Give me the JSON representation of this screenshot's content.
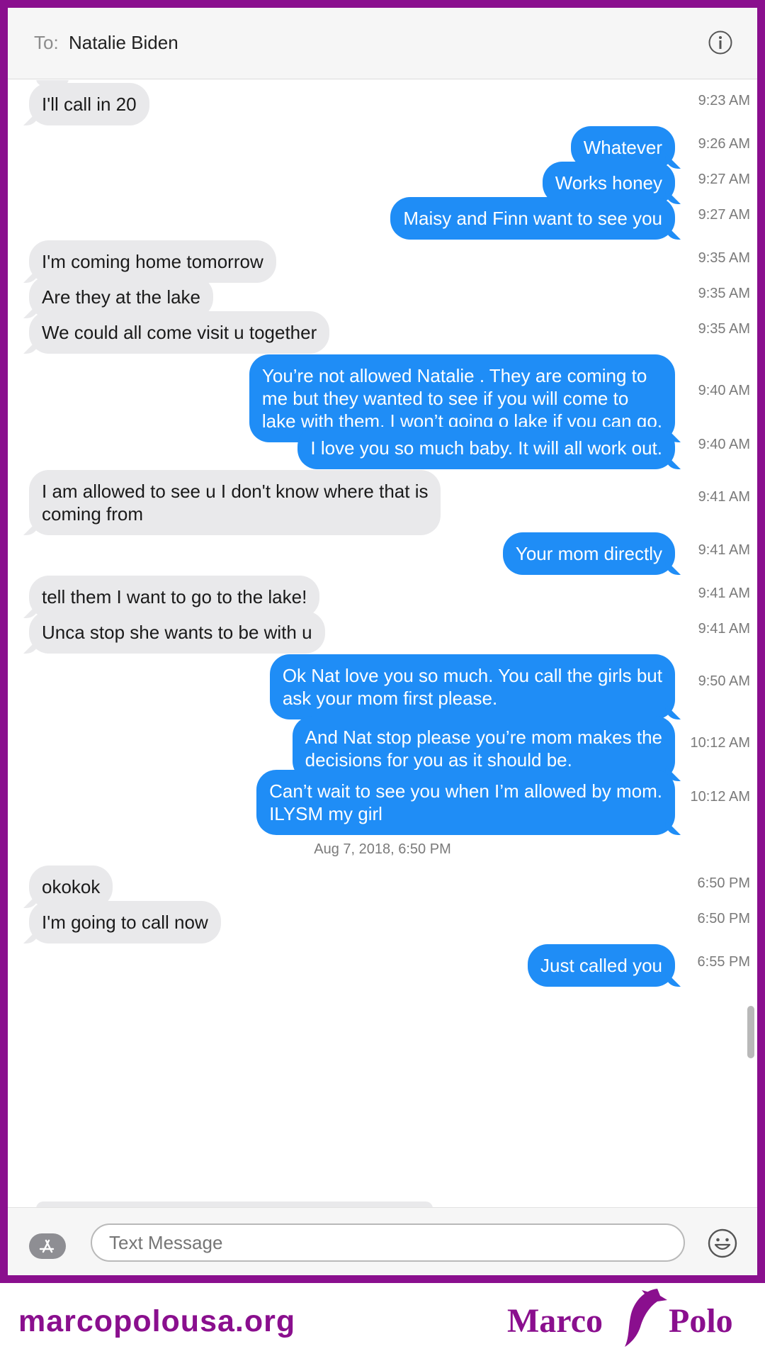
{
  "header": {
    "to_label": "To:",
    "recipient": "Natalie Biden"
  },
  "messages": [
    {
      "side": "in",
      "text": "I'll call in 20",
      "time": "9:23 AM"
    },
    {
      "side": "out",
      "text": "Whatever",
      "time": "9:26 AM"
    },
    {
      "side": "out",
      "text": "Works honey",
      "time": "9:27 AM"
    },
    {
      "side": "out",
      "text": "Maisy and Finn want to see you",
      "time": "9:27 AM"
    },
    {
      "side": "in",
      "text": "I'm coming home tomorrow",
      "time": "9:35 AM"
    },
    {
      "side": "in",
      "text": "Are they at the lake",
      "time": "9:35 AM"
    },
    {
      "side": "in",
      "text": "We could all come visit u together",
      "time": "9:35 AM"
    },
    {
      "side": "out",
      "text": "You’re not allowed Natalie . They are coming to\nme but they wanted to see if you will come to\nlake with them. I won’t going o lake if you can go.",
      "time": "9:40 AM"
    },
    {
      "side": "out",
      "text": "I love you so much baby. It will all work out.",
      "time": "9:40 AM"
    },
    {
      "side": "in",
      "text": "I am allowed to see u I don't know where that is\ncoming from",
      "time": "9:41 AM"
    },
    {
      "side": "out",
      "text": "Your mom directly",
      "time": "9:41 AM"
    },
    {
      "side": "in",
      "text": "tell them I want to go to the lake!",
      "time": "9:41 AM"
    },
    {
      "side": "in",
      "text": "Unca stop she wants to be with u",
      "time": "9:41 AM"
    },
    {
      "side": "out",
      "text": "Ok Nat love you so much. You call the girls but\nask your mom first please.",
      "time": "9:50 AM"
    },
    {
      "side": "out",
      "text": "And Nat stop please you’re mom makes the\ndecisions for you as it should be.",
      "time": "10:12 AM"
    },
    {
      "side": "out",
      "text": "Can’t wait to see you when I’m allowed by mom.\nILYSM my girl",
      "time": "10:12 AM"
    },
    {
      "side": "date",
      "text": "Aug 7, 2018, 6:50 PM"
    },
    {
      "side": "in",
      "text": "okokok",
      "time": "6:50 PM"
    },
    {
      "side": "in",
      "text": "I'm going to call now",
      "time": "6:50 PM"
    },
    {
      "side": "out",
      "text": "Just called you",
      "time": "6:55 PM"
    }
  ],
  "composer": {
    "placeholder": "Text Message"
  },
  "footer": {
    "url": "marcopolousa.org",
    "brand_first": "Marco",
    "brand_second": "Polo"
  },
  "colors": {
    "frame": "#8a0f8e",
    "outgoing": "#1f8df6",
    "incoming": "#e9e9eb"
  },
  "icons": [
    "info-icon",
    "app-store-icon",
    "emoji-icon",
    "dolphin-logo"
  ]
}
